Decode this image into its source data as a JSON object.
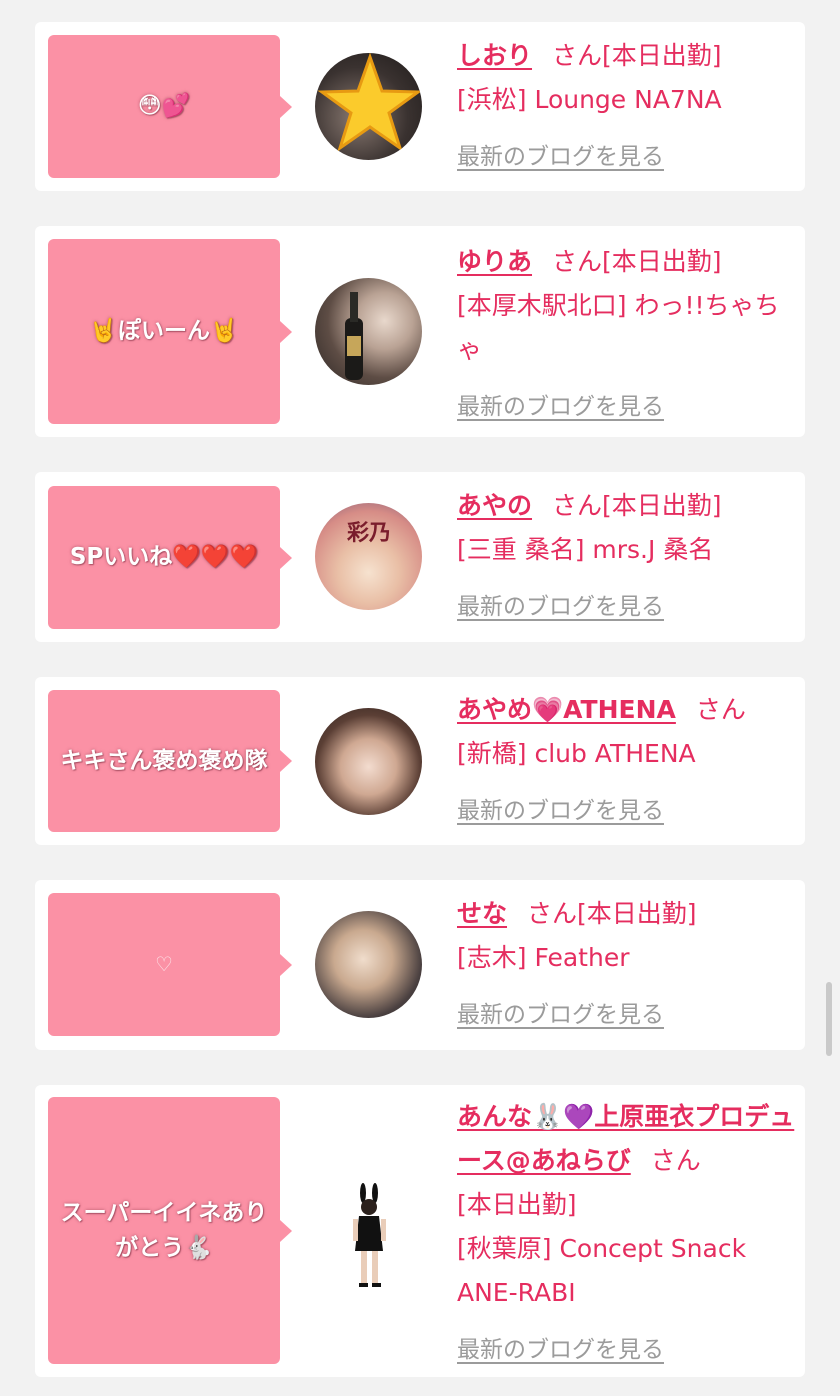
{
  "posts": [
    {
      "bubble": "😳💕",
      "name": "しおり",
      "san": "さん",
      "status": "[本日出勤]",
      "shop": "[浜松] Lounge NA7NA",
      "blog_link": "最新のブログを見る",
      "avatar_icon": "star-emoji-avatar"
    },
    {
      "bubble": "🤘ぽいーん🤘",
      "name": "ゆりあ",
      "san": "さん",
      "status": "[本日出勤]",
      "shop": "[本厚木駅北口] わっ!!ちゃちゃ",
      "blog_link": "最新のブログを見る",
      "avatar_icon": "photo-avatar"
    },
    {
      "bubble": "SPいいね❤️❤️❤️",
      "name": "あやの",
      "san": "さん",
      "status": "[本日出勤]",
      "shop": "[三重 桑名] mrs.J 桑名",
      "blog_link": "最新のブログを見る",
      "avatar_text": "彩乃"
    },
    {
      "bubble": "キキさん褒め褒め隊",
      "name": "あやめ💗ATHENA",
      "san": "さん",
      "status": "",
      "shop": "[新橋] club ATHENA",
      "blog_link": "最新のブログを見る",
      "avatar_icon": "photo-avatar"
    },
    {
      "bubble": "♡",
      "name": "せな",
      "san": "さん",
      "status": "[本日出勤]",
      "shop": "[志木] Feather",
      "blog_link": "最新のブログを見る",
      "avatar_icon": "photo-avatar"
    },
    {
      "bubble": "スーパーイイネありがとう🐇",
      "name": "あんな🐰💜上原亜衣プロデュース@あねらび",
      "san": "さん",
      "status": "[本日出勤]",
      "shop": "[秋葉原] Concept Snack ANE-RABI",
      "blog_link": "最新のブログを見る",
      "avatar_icon": "bunny-costume-figure"
    }
  ],
  "colors": {
    "background": "#f2f2f2",
    "bubble": "#fb91a5",
    "accent": "#e52d5f",
    "link_gray": "#9b9b9b"
  }
}
